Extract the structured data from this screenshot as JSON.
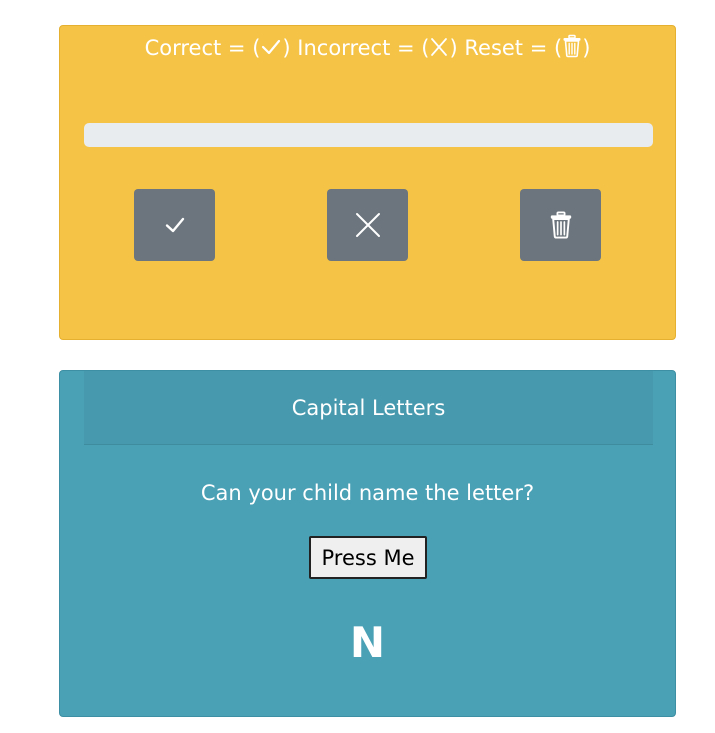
{
  "score_panel": {
    "legend": {
      "correct_label": "Correct =",
      "incorrect_label": "Incorrect =",
      "reset_label": "Reset =",
      "open_paren": "(",
      "close_paren": ")"
    },
    "progress": {
      "value_percent": 0
    },
    "buttons": {
      "correct_icon": "check-icon",
      "incorrect_icon": "close-icon",
      "reset_icon": "trash-icon"
    },
    "colors": {
      "panel_background": "#f5c345",
      "button_background": "#6c757d",
      "progress_track": "#e9ecef"
    }
  },
  "letter_panel": {
    "header": "Capital Letters",
    "prompt": "Can your child name the letter?",
    "press_button_label": "Press Me",
    "current_letter": "N",
    "colors": {
      "panel_background": "#4aa0b5"
    }
  }
}
